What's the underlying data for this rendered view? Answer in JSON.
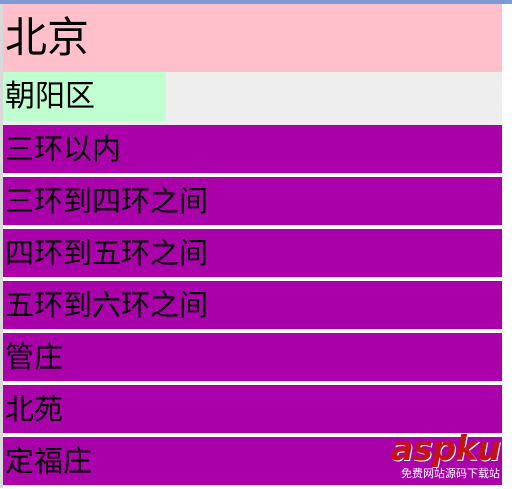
{
  "city": {
    "label": "北京"
  },
  "district": {
    "label": "朝阳区"
  },
  "areas": [
    {
      "label": "三环以内"
    },
    {
      "label": "三环到四环之间"
    },
    {
      "label": "四环到五环之间"
    },
    {
      "label": "五环到六环之间"
    },
    {
      "label": "管庄"
    },
    {
      "label": "北苑"
    },
    {
      "label": "定福庄"
    }
  ],
  "watermark": {
    "main": "aspku",
    "sub": "免费网站源码下载站"
  },
  "colors": {
    "city_bg": "#ffc0cb",
    "district_bg": "#c0ffd0",
    "district_row_bg": "#eeeeee",
    "area_bg": "#aa00aa",
    "watermark_red": "#c11414"
  }
}
